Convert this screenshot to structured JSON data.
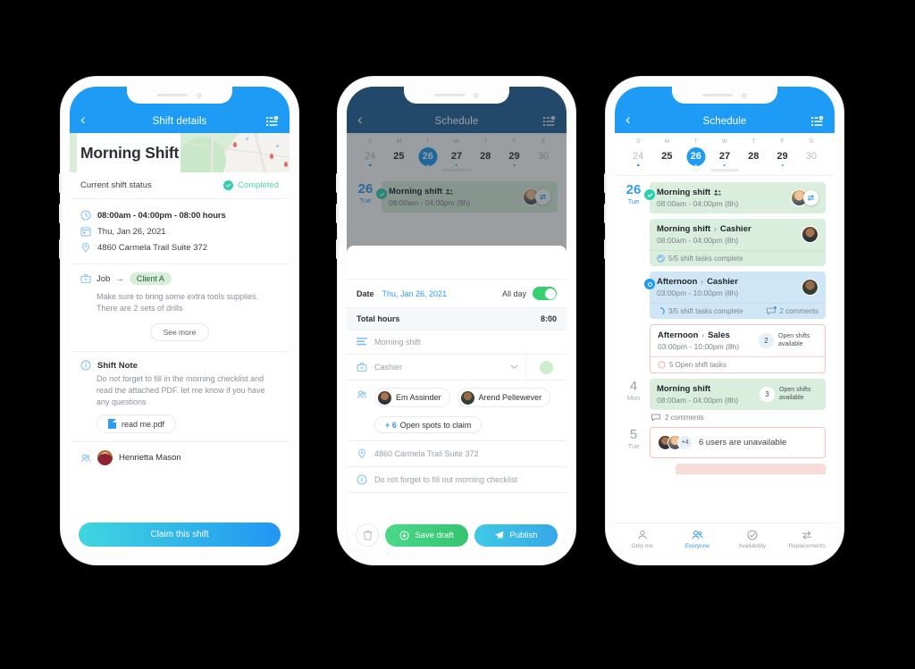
{
  "phone1": {
    "nav": {
      "back": "‹",
      "title": "Shift details",
      "menu_icon": "agenda-clock-icon"
    },
    "hero_title": "Morning Shift",
    "status": {
      "label": "Current shift status",
      "value": "Completed",
      "color": "#4fd3b4"
    },
    "details": [
      {
        "icon": "clock-icon",
        "text": "08:00am - 04:00pm - 08:00 hours",
        "bold": true
      },
      {
        "icon": "calendar-icon",
        "text": "Thu, Jan 26, 2021",
        "bold": false
      },
      {
        "icon": "location-pin-icon",
        "text": "4860 Carmela Trail Suite 372",
        "bold": false
      }
    ],
    "job": {
      "label": "Job",
      "arrow": "→",
      "client": "Client A",
      "description": "Make sure to bring some extra tools supplies. There are 2 sets of drills",
      "see_more": "See more"
    },
    "note": {
      "title": "Shift Note",
      "body": "Do not forget to fill in the morning checklist and read the attached PDF. let me know if you have any questions",
      "attachment": "read me.pdf"
    },
    "assignee": "Henrietta Mason",
    "cta": "Claim this shift"
  },
  "phone2": {
    "nav": {
      "back": "‹",
      "title": "Schedule",
      "menu_icon": "agenda-clock-icon"
    },
    "calendar": {
      "dow": [
        "S",
        "M",
        "T",
        "W",
        "T",
        "F",
        "S"
      ],
      "days": [
        {
          "n": "24",
          "muted": true,
          "dot": true,
          "active": false
        },
        {
          "n": "25",
          "muted": false,
          "dot": false,
          "active": false
        },
        {
          "n": "26",
          "muted": false,
          "dot": true,
          "active": true
        },
        {
          "n": "27",
          "muted": false,
          "dot": true,
          "active": false
        },
        {
          "n": "28",
          "muted": false,
          "dot": false,
          "active": false
        },
        {
          "n": "29",
          "muted": false,
          "dot": true,
          "active": false
        },
        {
          "n": "30",
          "muted": true,
          "dot": false,
          "active": false
        }
      ]
    },
    "behind_card": {
      "day_n": "26",
      "day_w": "Tue",
      "title": "Morning shift",
      "time": "08:00am - 04:00pm (8h)"
    },
    "sheet": {
      "date_label": "Date",
      "date_value": "Thu, Jan 26, 2021",
      "allday_label": "All day",
      "allday_on": true,
      "total_label": "Total hours",
      "total_value": "8:00",
      "shift_name": "Morning shift",
      "role": "Cashier",
      "users": [
        {
          "name": "Em Assinder"
        },
        {
          "name": "Arend Pellewever"
        }
      ],
      "open_spots": {
        "count": "+ 6",
        "label": "Open spots to claim"
      },
      "address": "4860 Carmela Trail Suite 372",
      "note": "Do not forget to fill out morning checklist",
      "delete_icon": "trash-icon",
      "save_label": "Save draft",
      "publish_label": "Publish"
    }
  },
  "phone3": {
    "nav": {
      "back": "‹",
      "title": "Schedule",
      "menu_icon": "agenda-clock-icon"
    },
    "calendar": {
      "dow": [
        "S",
        "M",
        "T",
        "W",
        "T",
        "F",
        "S"
      ],
      "days": [
        {
          "n": "24",
          "muted": true,
          "dot": true,
          "active": false
        },
        {
          "n": "25",
          "muted": false,
          "dot": false,
          "active": false
        },
        {
          "n": "26",
          "muted": false,
          "dot": true,
          "active": true
        },
        {
          "n": "27",
          "muted": false,
          "dot": true,
          "active": false
        },
        {
          "n": "28",
          "muted": false,
          "dot": false,
          "active": false
        },
        {
          "n": "29",
          "muted": false,
          "dot": true,
          "active": false
        },
        {
          "n": "30",
          "muted": true,
          "dot": false,
          "active": false
        }
      ]
    },
    "days": [
      {
        "day_n": "26",
        "day_w": "Tue",
        "grey": false,
        "cards": [
          {
            "variant": "green",
            "badge": "check",
            "title": "Morning shift",
            "sub": "",
            "group_icon": true,
            "time": "08:00am - 04:00pm (8h)",
            "avatars": [
              "m1"
            ],
            "swap": true,
            "foot": []
          },
          {
            "variant": "green",
            "badge": "none",
            "title": "Morning shift",
            "chev": "›",
            "sub": "Cashier",
            "time": "08:00am - 04:00pm (8h)",
            "avatars": [
              "m2"
            ],
            "foot": [
              {
                "icon": "check-circle-icon",
                "text": "5/5 shift tasks complete",
                "tone": "blue"
              }
            ]
          },
          {
            "variant": "blue",
            "badge": "ring",
            "title": "Afternoon",
            "chev": "›",
            "sub": "Cashier",
            "time": "03:00pm - 10:00pm (8h)",
            "avatars": [
              "m3"
            ],
            "foot": [
              {
                "icon": "progress-circle-icon",
                "text": "3/5 shift tasks complete",
                "tone": "blue"
              },
              {
                "icon": "comment-icon",
                "text": "2 comments",
                "tone": "grey",
                "badge_dot": true
              }
            ]
          },
          {
            "variant": "white-red",
            "badge": "none",
            "title": "Afternoon",
            "chev": "›",
            "sub": "Sales",
            "time": "03:00pm - 10:00pm (8h)",
            "open": {
              "count": "2",
              "label": "Open shifts available"
            },
            "foot": [
              {
                "icon": "empty-circle-icon",
                "text": "5 Open shift tasks",
                "tone": "red"
              }
            ]
          }
        ]
      },
      {
        "day_n": "4",
        "day_w": "Mon",
        "grey": true,
        "cards": [
          {
            "variant": "green",
            "badge": "none",
            "title": "Morning shift",
            "sub": "",
            "time": "08:00am - 04:00pm (8h)",
            "open": {
              "count": "3",
              "label": "Open shifts available"
            },
            "foot": [
              {
                "icon": "comment-icon",
                "text": "2 comments",
                "tone": "grey"
              }
            ]
          }
        ]
      },
      {
        "day_n": "5",
        "day_w": "Tue",
        "grey": true,
        "unavailable": {
          "extra": "+4",
          "text": "6 users are unavailable"
        }
      }
    ],
    "tabs": [
      {
        "label": "Only me",
        "icon": "user-icon",
        "active": false,
        "dot": false
      },
      {
        "label": "Everyone",
        "icon": "users-icon",
        "active": true,
        "dot": false
      },
      {
        "label": "Availability",
        "icon": "check-circle-icon",
        "active": false,
        "dot": false
      },
      {
        "label": "Replacements",
        "icon": "swap-icon",
        "active": false,
        "dot": true
      }
    ]
  }
}
